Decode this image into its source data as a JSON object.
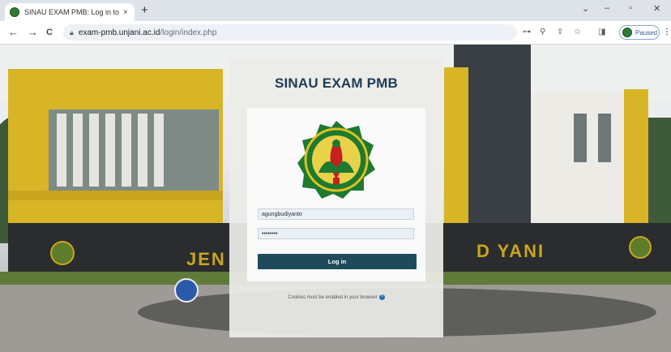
{
  "browser": {
    "tab_title": "SINAU EXAM PMB: Log in to the",
    "tab_close": "×",
    "new_tab": "+",
    "url_domain": "exam-pmb.unjani.ac.id",
    "url_path": "/login/index.php",
    "profile_status": "Paused",
    "nav": {
      "back": "←",
      "forward": "→",
      "reload": "C"
    },
    "window": {
      "chevron": "⌄",
      "minimize": "–",
      "restore": "▫",
      "close": "✕"
    },
    "toolbar_icons": {
      "key": "⊶",
      "zoom": "⚲",
      "share": "⇪",
      "star": "☆",
      "panel": "◨",
      "menu": "⋮"
    },
    "colors": {
      "chrome": "#dee3ea",
      "toolbar": "#ffffff"
    }
  },
  "login": {
    "site_title": "SINAU EXAM PMB",
    "username": "agungbudiyanto",
    "password": "••••••••",
    "login_button": "Log in",
    "cookies_notice": "Cookies must be enabled in your browser",
    "help_glyph": "?",
    "accent": "#1f4a5c"
  },
  "background": {
    "building_sign_left": "JEN",
    "building_sign_right": "D YANI"
  }
}
